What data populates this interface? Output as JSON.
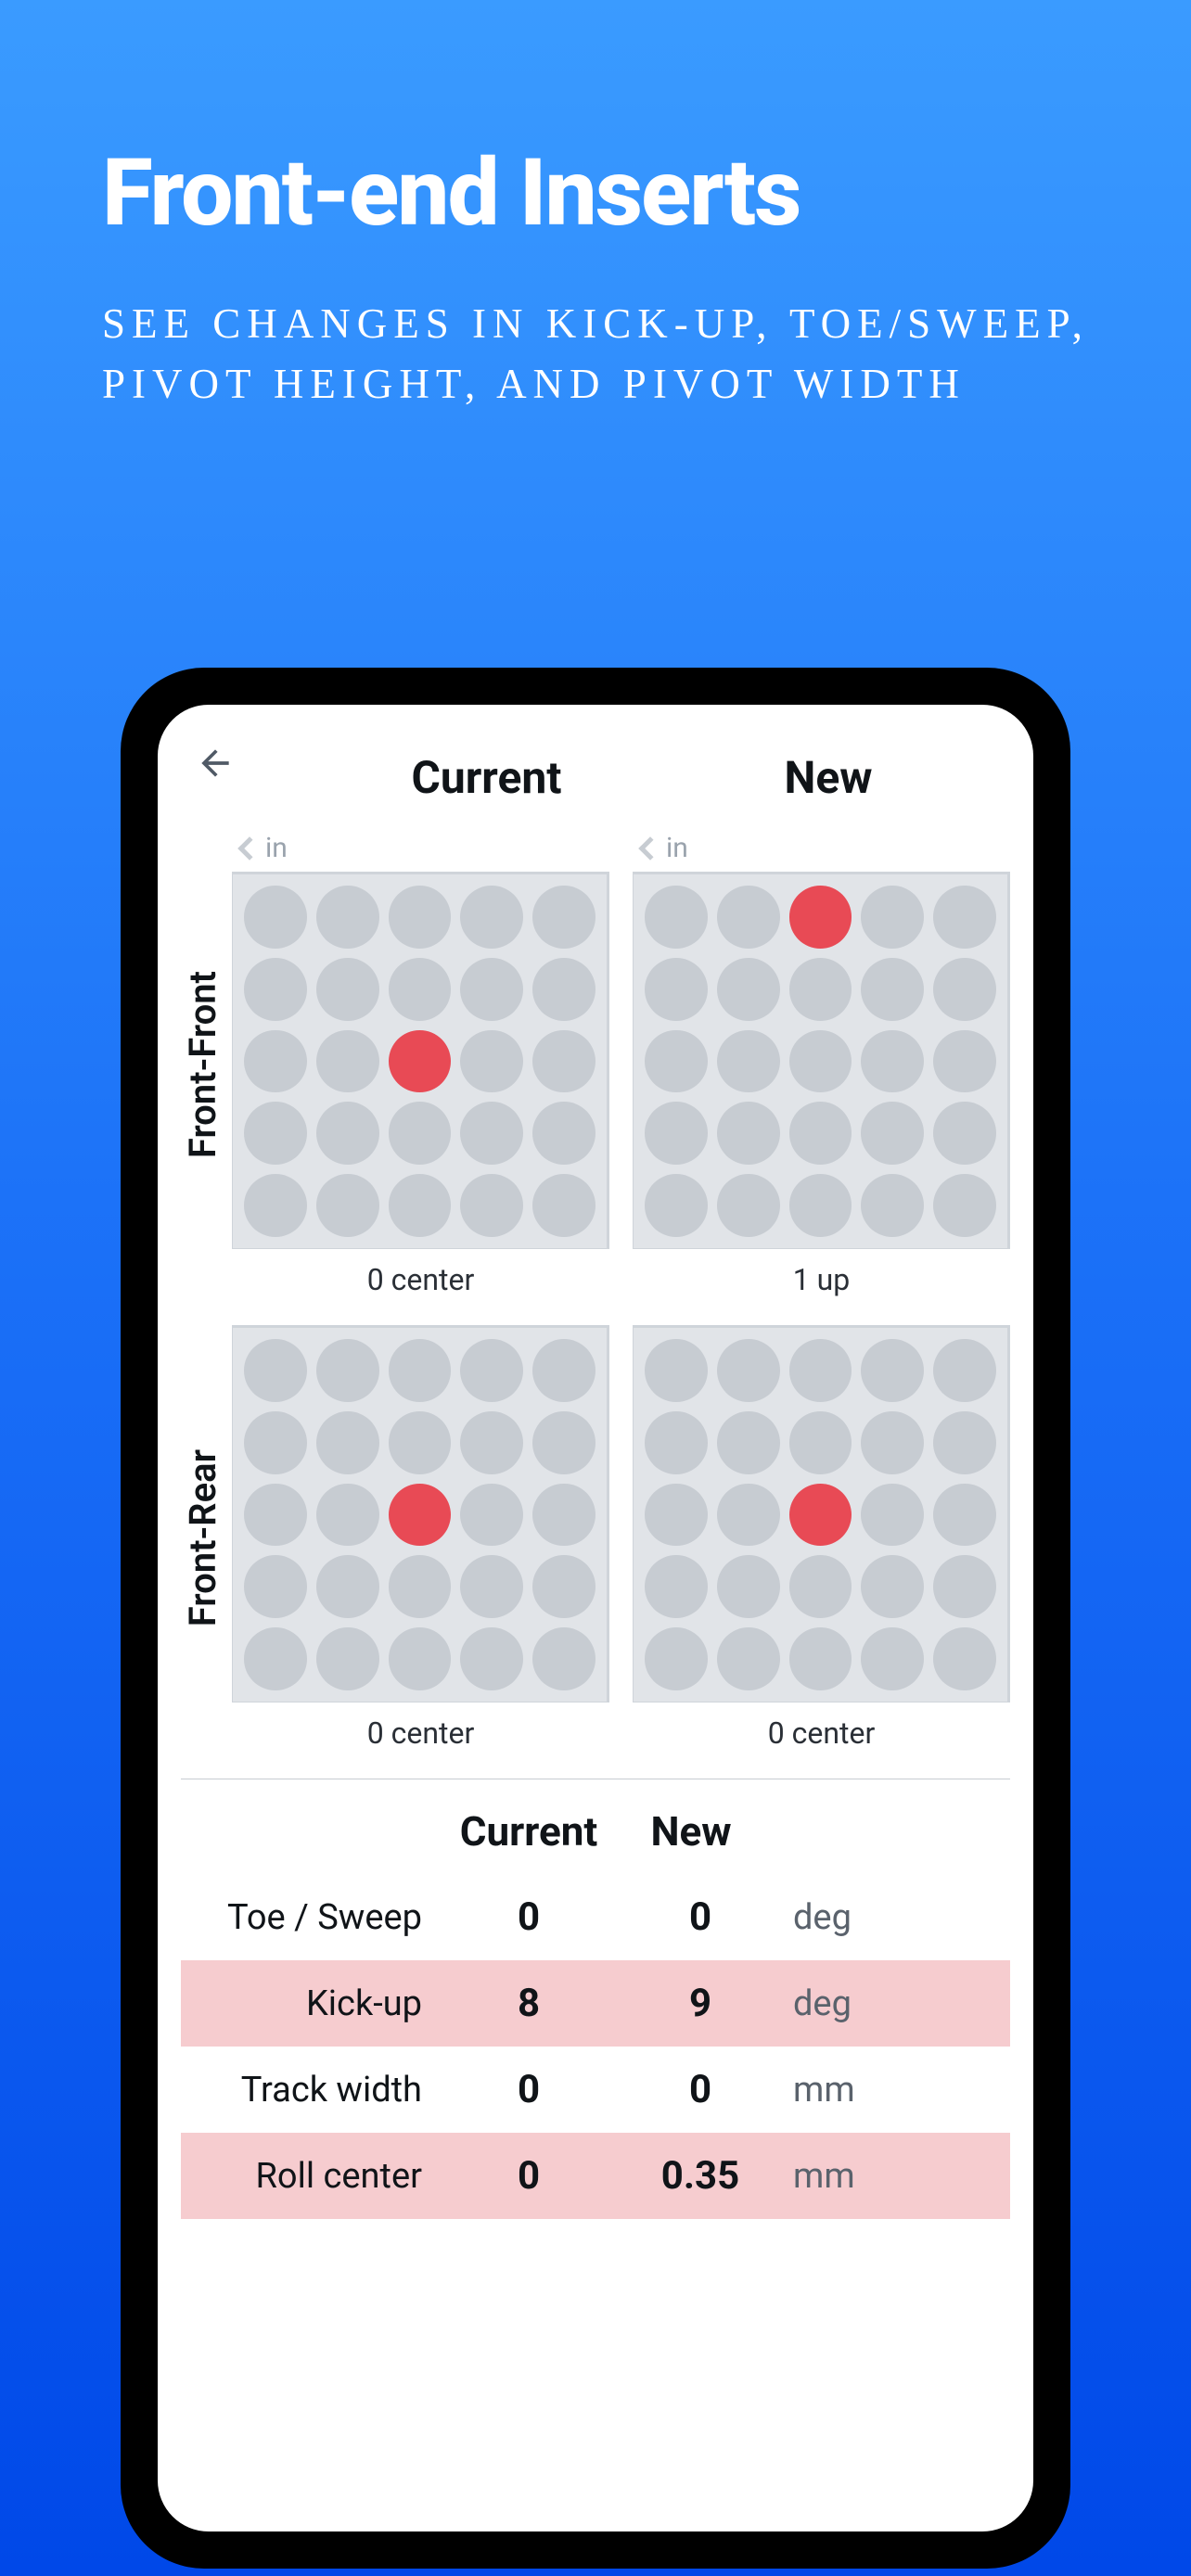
{
  "header": {
    "title": "Front-end Inserts",
    "subtitle": "SEE CHANGES IN KICK-UP, TOE/SWEEP, PIVOT HEIGHT, AND PIVOT WIDTH"
  },
  "columns": {
    "current": "Current",
    "new": "New"
  },
  "grids": {
    "in_label": "in",
    "rows": [
      {
        "label": "Front-Front",
        "current": {
          "selected": [
            2,
            2
          ],
          "caption": "0 center"
        },
        "new": {
          "selected": [
            0,
            2
          ],
          "caption": "1 up"
        }
      },
      {
        "label": "Front-Rear",
        "current": {
          "selected": [
            2,
            2
          ],
          "caption": "0 center"
        },
        "new": {
          "selected": [
            2,
            2
          ],
          "caption": "0 center"
        }
      }
    ]
  },
  "table": {
    "headers": {
      "current": "Current",
      "new": "New"
    },
    "rows": [
      {
        "label": "Toe / Sweep",
        "current": "0",
        "new": "0",
        "unit": "deg",
        "highlight": false
      },
      {
        "label": "Kick-up",
        "current": "8",
        "new": "9",
        "unit": "deg",
        "highlight": true
      },
      {
        "label": "Track width",
        "current": "0",
        "new": "0",
        "unit": "mm",
        "highlight": false
      },
      {
        "label": "Roll center",
        "current": "0",
        "new": "0.35",
        "unit": "mm",
        "highlight": true
      }
    ]
  }
}
